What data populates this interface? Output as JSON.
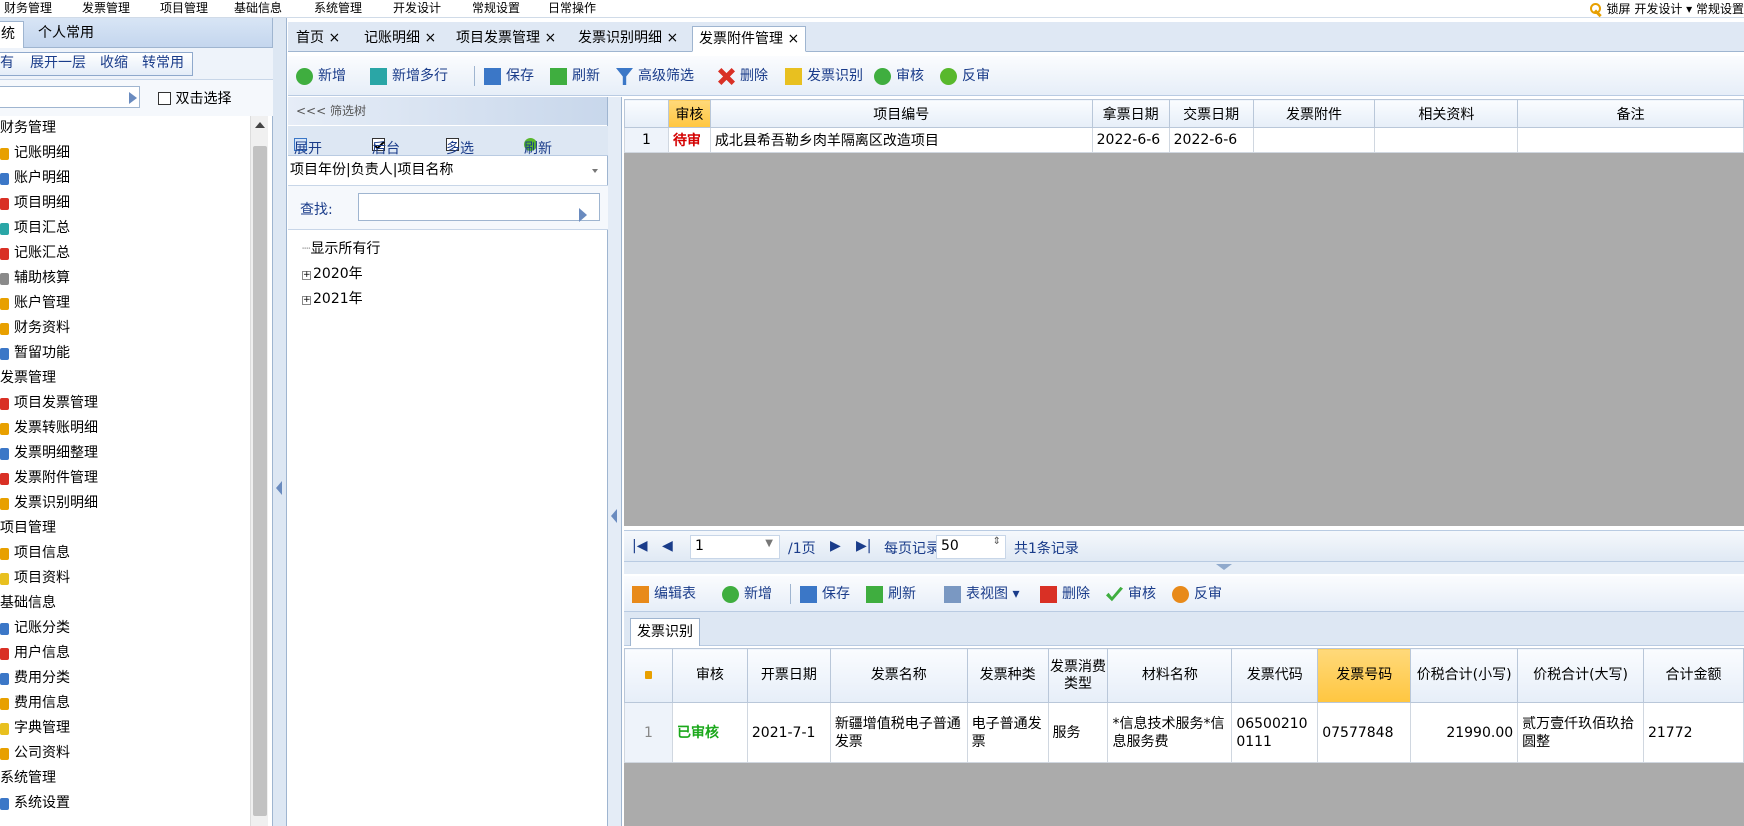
{
  "menu": [
    "财务管理",
    "发票管理",
    "项目管理",
    "基础信息",
    "系统管理",
    "开发设计",
    "常规设置",
    "日常操作"
  ],
  "menu_right": "锁屏 开发设计 ▾ 常规设置",
  "left_tabs": [
    "统",
    "个人常用"
  ],
  "left_toolbar": [
    "有",
    "展开一层",
    "收缩",
    "转常用"
  ],
  "left_dbl": "双击选择",
  "left_tree": [
    {
      "t": "财务管理",
      "g": true
    },
    {
      "t": "记账明细",
      "c": "#e8a000"
    },
    {
      "t": "账户明细",
      "c": "#3b77c7"
    },
    {
      "t": "项目明细",
      "c": "#d93025"
    },
    {
      "t": "项目汇总",
      "c": "#2aa6a6"
    },
    {
      "t": "记账汇总",
      "c": "#d93025"
    },
    {
      "t": "辅助核算",
      "c": "#8a8a8a"
    },
    {
      "t": "账户管理",
      "c": "#e8a000"
    },
    {
      "t": "财务资料",
      "c": "#e8a000"
    },
    {
      "t": "暂留功能",
      "c": "#3b77c7"
    },
    {
      "t": "发票管理",
      "g": true
    },
    {
      "t": "项目发票管理",
      "c": "#d93025"
    },
    {
      "t": "发票转账明细",
      "c": "#e8a000"
    },
    {
      "t": "发票明细整理",
      "c": "#3b77c7"
    },
    {
      "t": "发票附件管理",
      "c": "#d93025"
    },
    {
      "t": "发票识别明细",
      "c": "#e8a000"
    },
    {
      "t": "项目管理",
      "g": true
    },
    {
      "t": "项目信息",
      "c": "#e8a000"
    },
    {
      "t": "项目资料",
      "c": "#e8c020"
    },
    {
      "t": "基础信息",
      "g": true
    },
    {
      "t": "记账分类",
      "c": "#3b77c7"
    },
    {
      "t": "用户信息",
      "c": "#d93025"
    },
    {
      "t": "费用分类",
      "c": "#3b77c7"
    },
    {
      "t": "费用信息",
      "c": "#e8a000"
    },
    {
      "t": "字典管理",
      "c": "#e8c020"
    },
    {
      "t": "公司资料",
      "c": "#e8a000"
    },
    {
      "t": "系统管理",
      "g": true
    },
    {
      "t": "系统设置",
      "c": "#3b77c7"
    }
  ],
  "tabs": [
    {
      "label": "首页 ×"
    },
    {
      "label": "记账明细 ×"
    },
    {
      "label": "项目发票管理 ×"
    },
    {
      "label": "发票识别明细 ×"
    },
    {
      "label": "发票附件管理 ×"
    }
  ],
  "toolbar": [
    "新增",
    "新增多行",
    "保存",
    "刷新",
    "高级筛选",
    "删除",
    "发票识别",
    "审核",
    "反审"
  ],
  "filter": {
    "head": "<<< 筛选树",
    "expand": "展开",
    "backend": "后台",
    "multi": "多选",
    "refresh": "刷新",
    "combo": "项目年份|负责人|项目名称",
    "find": "查找:",
    "tree": [
      "显示所有行",
      "2020年",
      "2021年"
    ]
  },
  "upper_grid": {
    "headers": [
      "",
      "审核",
      "项目编号",
      "拿票日期",
      "交票日期",
      "发票附件",
      "相关资料",
      "备注"
    ],
    "rows": [
      [
        "1",
        "待审",
        "成北县希吾勒乡肉羊隔离区改造项目",
        "2022-6-6",
        "2022-6-6",
        "",
        "",
        ""
      ]
    ]
  },
  "pager": {
    "page": "1",
    "total_pages": "/1页",
    "per_page_label": "每页记录",
    "per_page": "50",
    "total": "共1条记录"
  },
  "lower_toolbar": [
    "编辑表",
    "新增",
    "保存",
    "刷新",
    "表视图",
    "删除",
    "审核",
    "反审"
  ],
  "lower_tab": "发票识别",
  "lower_grid": {
    "headers": [
      "",
      "审核",
      "开票日期",
      "发票名称",
      "发票种类",
      "发票消费类型",
      "材料名称",
      "发票代码",
      "发票号码",
      "价税合计(小写)",
      "价税合计(大写)",
      "合计金额"
    ],
    "rows": [
      [
        "1",
        "已审核",
        "2021-7-1",
        "新疆增值税电子普通发票",
        "电子普通发票",
        "服务",
        "*信息技术服务*信息服务费",
        "065002100111",
        "07577848",
        "21990.00",
        "贰万壹仟玖佰玖拾圆整",
        "21772"
      ]
    ]
  }
}
